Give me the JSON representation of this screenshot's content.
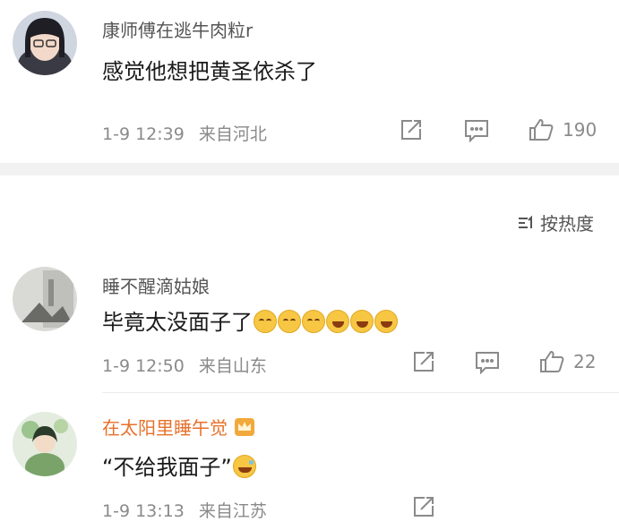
{
  "comments": [
    {
      "username": "康师傅在逃牛肉粒r",
      "text": "感觉他想把黄圣依杀了",
      "time": "1-9 12:39",
      "location": "来自河北",
      "likes": "190"
    },
    {
      "username": "睡不醒滴姑娘",
      "text": "毕竟太没面子了",
      "time": "1-9 12:50",
      "location": "来自山东",
      "likes": "22"
    },
    {
      "username": "在太阳里睡午觉",
      "text": "“不给我面子”",
      "time": "1-9 13:13",
      "location": "来自江苏",
      "likes": ""
    }
  ],
  "sort": {
    "label": "按热度"
  },
  "colors": {
    "vip_name": "#e8702a",
    "meta": "#8a8a8a",
    "band": "#f2f2f2"
  },
  "icons": [
    "share-icon",
    "comment-icon",
    "like-icon",
    "sort-icon",
    "emoji-cry",
    "emoji-laugh",
    "emoji-lol",
    "vip-crown-badge"
  ]
}
